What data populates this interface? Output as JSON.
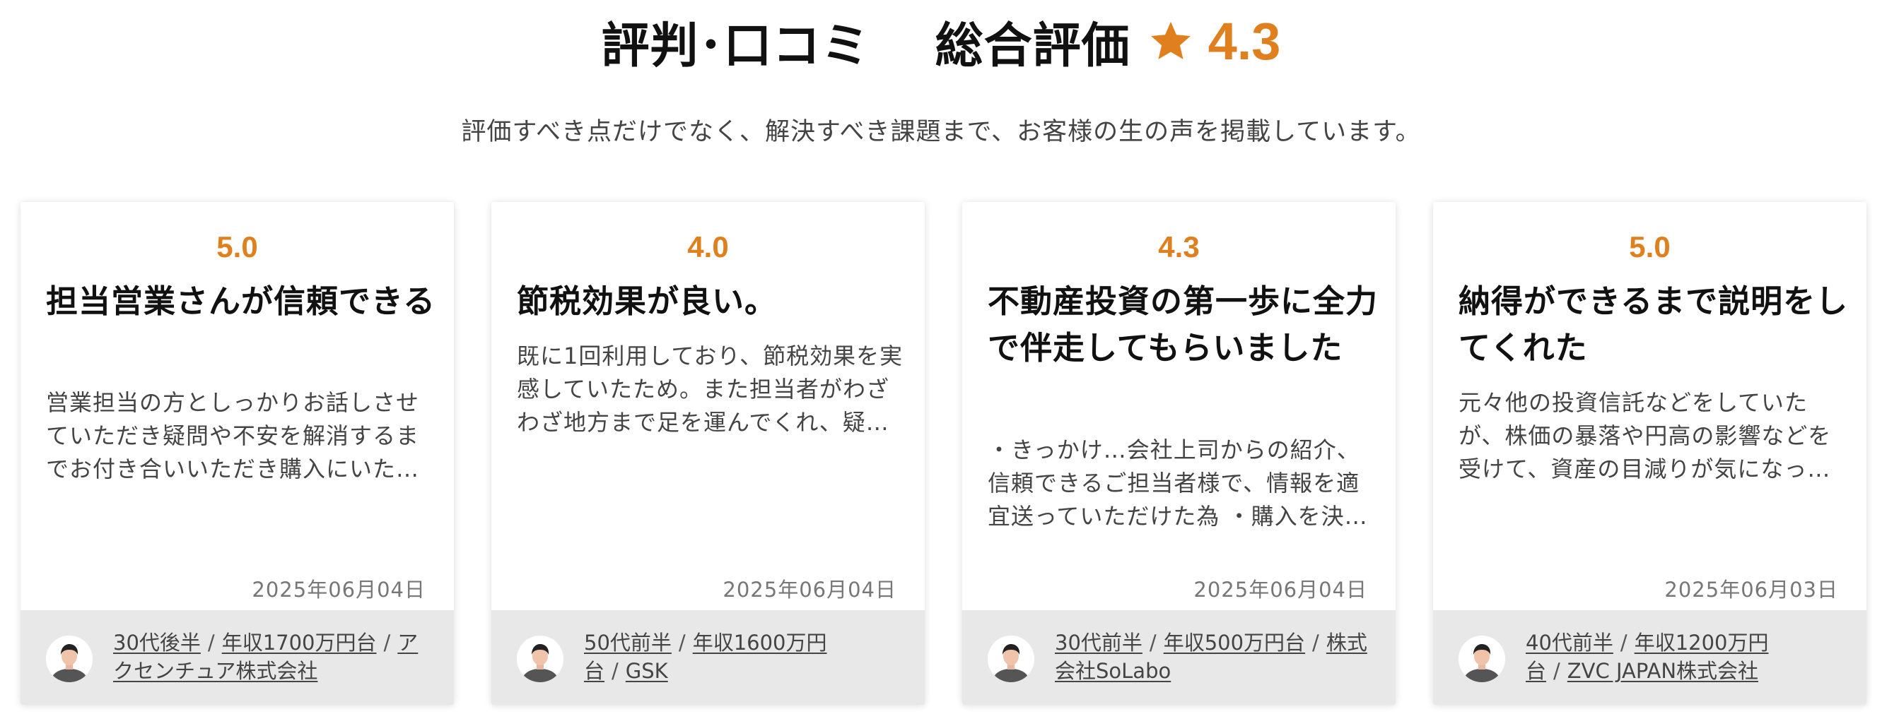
{
  "header": {
    "title": "評判･口コミ",
    "overall_label": "総合評価",
    "overall_score": "4.3",
    "subtitle": "評価すべき点だけでなく、解決すべき課題まで、お客様の生の声を掲載しています。"
  },
  "colors": {
    "accent": "#e07f1d",
    "footer_bg": "#e8e8e8"
  },
  "cards": [
    {
      "score": "5.0",
      "title": "担当営業さんが信頼できる",
      "body": "営業担当の方としっかりお話しさせていただき疑問や不安を解消するまでお付き合いいただき購入にいた…",
      "date": "2025年06月04日",
      "age": "30代後半",
      "income": "年収1700万円台",
      "company": "アクセンチュア株式会社"
    },
    {
      "score": "4.0",
      "title": "節税効果が良い。",
      "body": "既に1回利用しており、節税効果を実感していたため。また担当者がわざわざ地方まで足を運んでくれ、疑…",
      "date": "2025年06月04日",
      "age": "50代前半",
      "income": "年収1600万円台",
      "company": "GSK"
    },
    {
      "score": "4.3",
      "title": "不動産投資の第一歩に全力で伴走してもらいました",
      "body": "・きっかけ…会社上司からの紹介、信頼できるご担当者様で、情報を適宜送っていただけた為 ・購入を決…",
      "date": "2025年06月04日",
      "age": "30代前半",
      "income": "年収500万円台",
      "company": "株式会社SoLabo"
    },
    {
      "score": "5.0",
      "title": "納得ができるまで説明をしてくれた",
      "body": "元々他の投資信託などをしていたが、株価の暴落や円高の影響などを受けて、資産の目減りが気になっ…",
      "date": "2025年06月03日",
      "age": "40代前半",
      "income": "年収1200万円台",
      "company": "ZVC JAPAN株式会社"
    }
  ]
}
